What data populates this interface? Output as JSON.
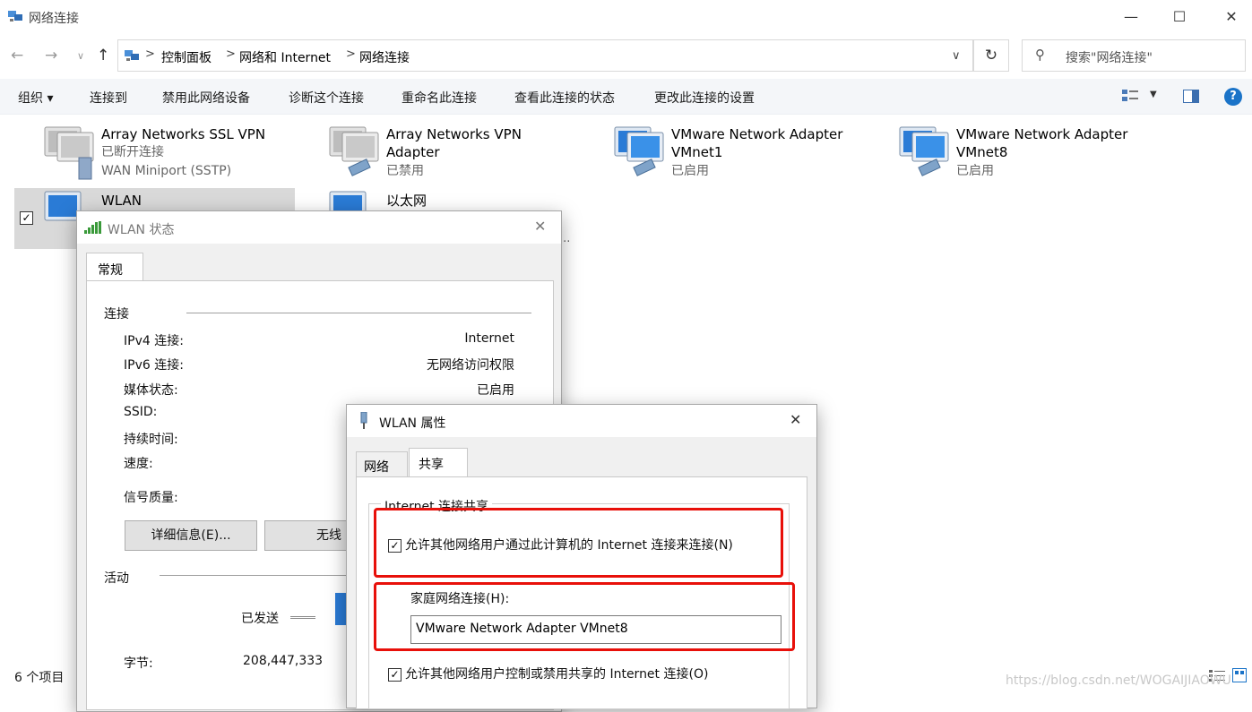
{
  "window": {
    "title": "网络连接",
    "minimize": "—",
    "maximize": "☐",
    "close": "✕"
  },
  "address": {
    "crumbs": [
      "控制面板",
      "网络和 Internet",
      "网络连接"
    ],
    "search_placeholder": "搜索\"网络连接\""
  },
  "toolbar": {
    "organize": "组织 ▾",
    "items": [
      "连接到",
      "禁用此网络设备",
      "诊断这个连接",
      "重命名此连接",
      "查看此连接的状态",
      "更改此连接的设置"
    ]
  },
  "items": [
    {
      "title": "Array Networks SSL VPN",
      "line2": "已断开连接",
      "line3": "WAN Miniport (SSTP)"
    },
    {
      "title": "Array Networks VPN",
      "title2": "Adapter",
      "line2": "已禁用"
    },
    {
      "title": "VMware Network Adapter",
      "title2": "VMnet1",
      "line2": "已启用"
    },
    {
      "title": "VMware Network Adapter",
      "title2": "VMnet8",
      "line2": "已启用"
    },
    {
      "title": "WLAN",
      "selected": true
    },
    {
      "title": "以太网",
      "line2": "..."
    }
  ],
  "status_bar": {
    "count": "6 个项目"
  },
  "wlan_status": {
    "title": "WLAN 状态",
    "tab": "常规",
    "section_connection": "连接",
    "rows": [
      {
        "label": "IPv4 连接:",
        "value": "Internet"
      },
      {
        "label": "IPv6 连接:",
        "value": "无网络访问权限"
      },
      {
        "label": "媒体状态:",
        "value": "已启用"
      },
      {
        "label": "SSID:",
        "value": ""
      },
      {
        "label": "持续时间:",
        "value": ""
      },
      {
        "label": "速度:",
        "value": ""
      },
      {
        "label": "信号质量:",
        "value": ""
      }
    ],
    "details_button": "详细信息(E)...",
    "wireless_button": "无线",
    "section_activity": "活动",
    "sent_label": "已发送",
    "bytes_label": "字节:",
    "bytes_value": "208,447,333"
  },
  "wlan_props": {
    "title": "WLAN 属性",
    "tabs": [
      "网络",
      "共享"
    ],
    "group": "Internet 连接共享",
    "allow_share": "允许其他网络用户通过此计算机的 Internet 连接来连接(N)",
    "home_label": "家庭网络连接(H):",
    "home_value": "VMware Network Adapter VMnet8",
    "allow_control": "允许其他网络用户控制或禁用共享的 Internet 连接(O)"
  },
  "watermark": "https://blog.csdn.net/WOGAIJIAOWU",
  "colors": {
    "highlight": "#e8100a",
    "selected": "#d9d9d9",
    "help": "#1a73c8"
  }
}
